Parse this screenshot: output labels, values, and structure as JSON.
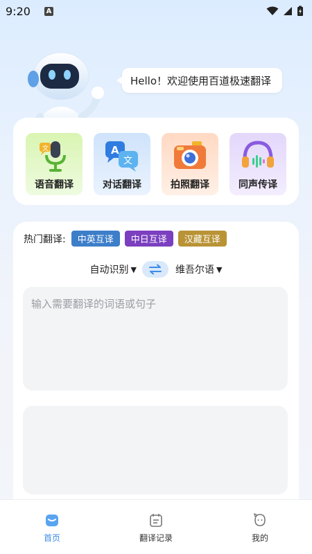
{
  "status_bar": {
    "time": "9:20",
    "indicator": "A"
  },
  "hero": {
    "greeting": "Hello！欢迎使用百道极速翻译"
  },
  "features": [
    {
      "label": "语音翻译",
      "icon": "microphone-icon"
    },
    {
      "label": "对话翻译",
      "icon": "chat-bubbles-icon"
    },
    {
      "label": "拍照翻译",
      "icon": "camera-icon"
    },
    {
      "label": "同声传译",
      "icon": "headphones-icon"
    }
  ],
  "translate": {
    "hot_label": "热门翻译:",
    "chips": [
      "中英互译",
      "中日互译",
      "汉藏互译"
    ],
    "source_lang": "自动识别",
    "target_lang": "维吾尔语",
    "dropdown_glyph": "▼",
    "input_placeholder": "输入需要翻译的词语或句子",
    "input_value": ""
  },
  "tabbar": {
    "items": [
      {
        "label": "首页",
        "icon": "home-icon",
        "active": true
      },
      {
        "label": "翻译记录",
        "icon": "history-icon",
        "active": false
      },
      {
        "label": "我的",
        "icon": "profile-icon",
        "active": false
      }
    ]
  },
  "colors": {
    "accent": "#3c8be8",
    "chip_blue": "#3d7ec9",
    "chip_purple": "#7b3fbf",
    "chip_gold": "#b99335"
  }
}
